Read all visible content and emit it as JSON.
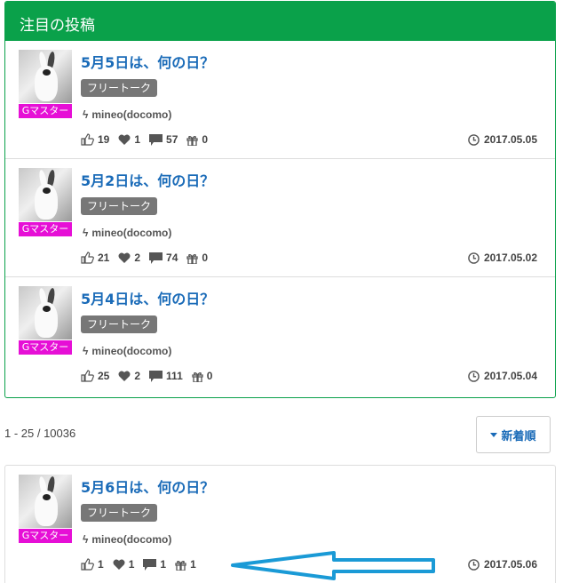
{
  "featured": {
    "header_title": "注目の投稿",
    "posts": [
      {
        "title": "5月5日は、何の日？",
        "badge": "Gマスター",
        "tag": "フリートーク",
        "carrier": "mineo(docomo)",
        "likes": "19",
        "hearts": "1",
        "comments": "57",
        "gifts": "0",
        "date": "2017.05.05"
      },
      {
        "title": "5月2日は、何の日？",
        "badge": "Gマスター",
        "tag": "フリートーク",
        "carrier": "mineo(docomo)",
        "likes": "21",
        "hearts": "2",
        "comments": "74",
        "gifts": "0",
        "date": "2017.05.02"
      },
      {
        "title": "5月4日は、何の日？",
        "badge": "Gマスター",
        "tag": "フリートーク",
        "carrier": "mineo(docomo)",
        "likes": "25",
        "hearts": "2",
        "comments": "111",
        "gifts": "0",
        "date": "2017.05.04"
      }
    ]
  },
  "pager": {
    "info": "1 - 25 / 10036",
    "sort_label": "新着順"
  },
  "list": {
    "post": {
      "title": "5月6日は、何の日？",
      "badge": "Gマスター",
      "tag": "フリートーク",
      "carrier": "mineo(docomo)",
      "likes": "1",
      "hearts": "1",
      "comments": "1",
      "gifts": "1",
      "date": "2017.05.06"
    }
  },
  "colors": {
    "accent_green": "#0aa14a",
    "link_blue": "#1a6bb8",
    "badge_magenta": "#e60fd6",
    "tag_gray": "#777777",
    "annotation_arrow": "#1a9ad6"
  },
  "icons": [
    "thumbs-up-icon",
    "heart-icon",
    "comment-icon",
    "gift-icon",
    "clock-icon",
    "bolt-icon",
    "caret-down-icon"
  ]
}
